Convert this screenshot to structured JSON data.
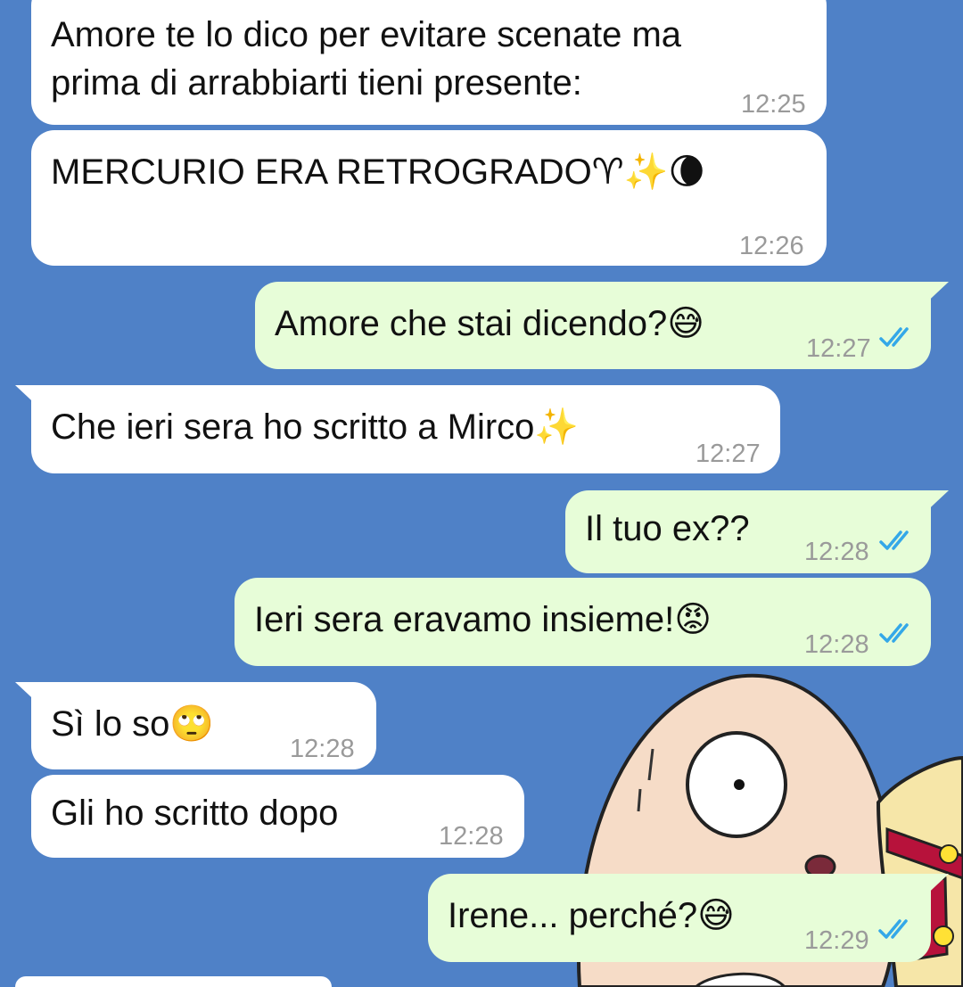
{
  "colors": {
    "wallpaper": "#4f81c7",
    "incoming_bubble": "#ffffff",
    "outgoing_bubble": "#e7fdd8",
    "timestamp": "#9a9a9a",
    "read_ticks": "#34a8e8"
  },
  "messages": [
    {
      "direction": "incoming",
      "text": "Amore te lo dico per evitare scenate ma prima di arrabbiarti tieni presente:",
      "time": "12:25"
    },
    {
      "direction": "incoming",
      "text": "MERCURIO ERA RETROGRADO♈✨🌘",
      "time": "12:26"
    },
    {
      "direction": "outgoing",
      "text": "Amore che stai dicendo?😅",
      "time": "12:27",
      "status": "read",
      "status_icon": "double-check-icon"
    },
    {
      "direction": "incoming",
      "text": "Che ieri sera ho scritto a Mirco✨",
      "time": "12:27"
    },
    {
      "direction": "outgoing",
      "text": "Il tuo ex??",
      "time": "12:28",
      "status": "read",
      "status_icon": "double-check-icon"
    },
    {
      "direction": "outgoing",
      "text": "Ieri sera eravamo insieme!😡",
      "time": "12:28",
      "status": "read",
      "status_icon": "double-check-icon"
    },
    {
      "direction": "incoming",
      "text": "Sì lo so🙄",
      "time": "12:28"
    },
    {
      "direction": "incoming",
      "text": "Gli ho scritto dopo",
      "time": "12:28"
    },
    {
      "direction": "outgoing",
      "text": "Irene... perché?😅",
      "time": "12:29",
      "status": "read",
      "status_icon": "double-check-icon"
    }
  ]
}
